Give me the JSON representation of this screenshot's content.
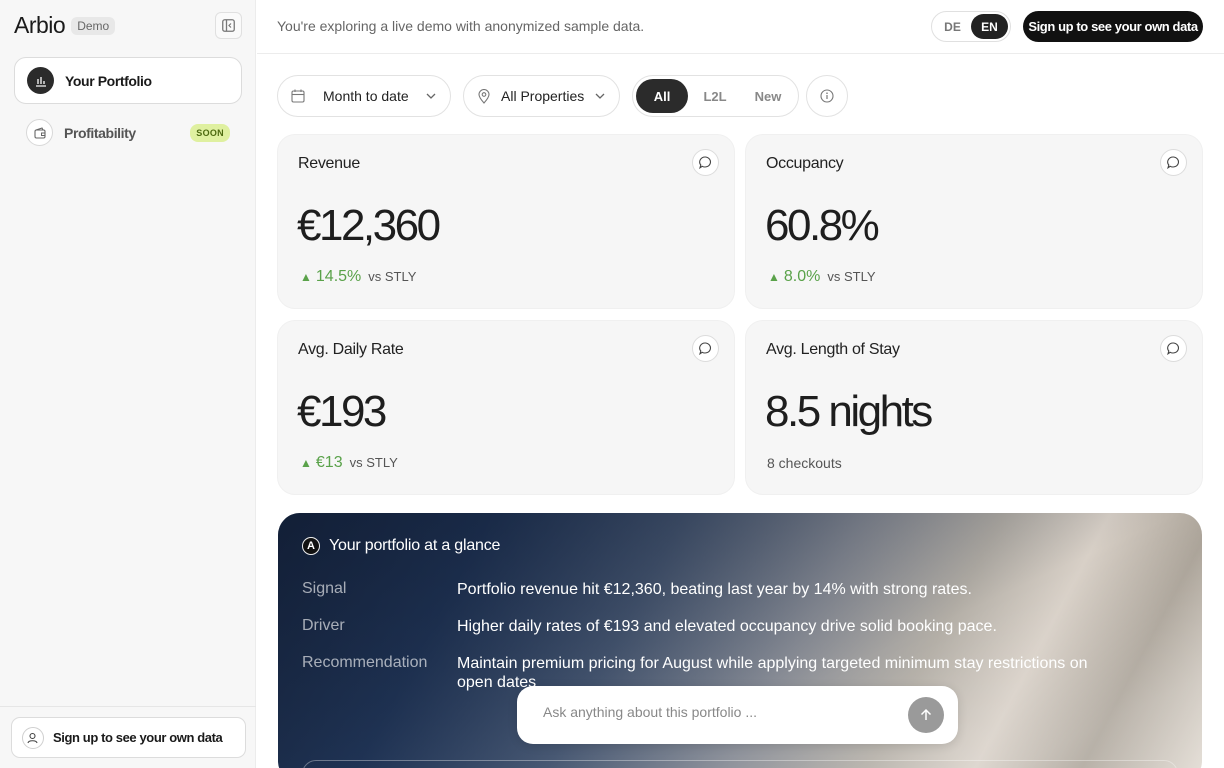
{
  "brand": {
    "name": "Arbio",
    "badge": "Demo"
  },
  "sidebar": {
    "items": [
      {
        "label": "Your Portfolio",
        "icon": "bar-chart-icon",
        "active": true
      },
      {
        "label": "Profitability",
        "icon": "wallet-icon",
        "badge": "SOON"
      }
    ],
    "footer_signup": "Sign up to see your own data"
  },
  "topbar": {
    "notice": "You're exploring a live demo with anonymized sample data.",
    "languages": [
      "DE",
      "EN"
    ],
    "active_language": "EN",
    "signup_label": "Sign up to see your own data"
  },
  "filters": {
    "date_range": "Month to date",
    "properties": "All Properties",
    "segments": [
      "All",
      "L2L",
      "New"
    ],
    "active_segment": "All"
  },
  "kpis": {
    "revenue": {
      "title": "Revenue",
      "value": "€12,360",
      "delta": "14.5%",
      "ref": "vs STLY"
    },
    "occupancy": {
      "title": "Occupancy",
      "value": "60.8%",
      "delta": "8.0%",
      "ref": "vs STLY"
    },
    "adr": {
      "title": "Avg. Daily Rate",
      "value": "€193",
      "delta": "€13",
      "ref": "vs STLY"
    },
    "los": {
      "title": "Avg. Length of Stay",
      "value": "8.5 nights",
      "sub": "8 checkouts"
    }
  },
  "glance": {
    "logo_letter": "A",
    "title": "Your portfolio at a glance",
    "rows": [
      {
        "key": "Signal",
        "value": "Portfolio revenue hit €12,360, beating last year by 14% with strong rates."
      },
      {
        "key": "Driver",
        "value": "Higher daily rates of €193 and elevated occupancy drive solid booking pace."
      },
      {
        "key": "Recommendation",
        "value": "Maintain premium pricing for August while applying targeted minimum stay restrictions on open dates"
      }
    ]
  },
  "ask": {
    "placeholder": "Ask anything about this portfolio ..."
  },
  "colors": {
    "positive": "#5aa24a",
    "primary_dark": "#111111",
    "soon_badge": "#dff0a0"
  }
}
